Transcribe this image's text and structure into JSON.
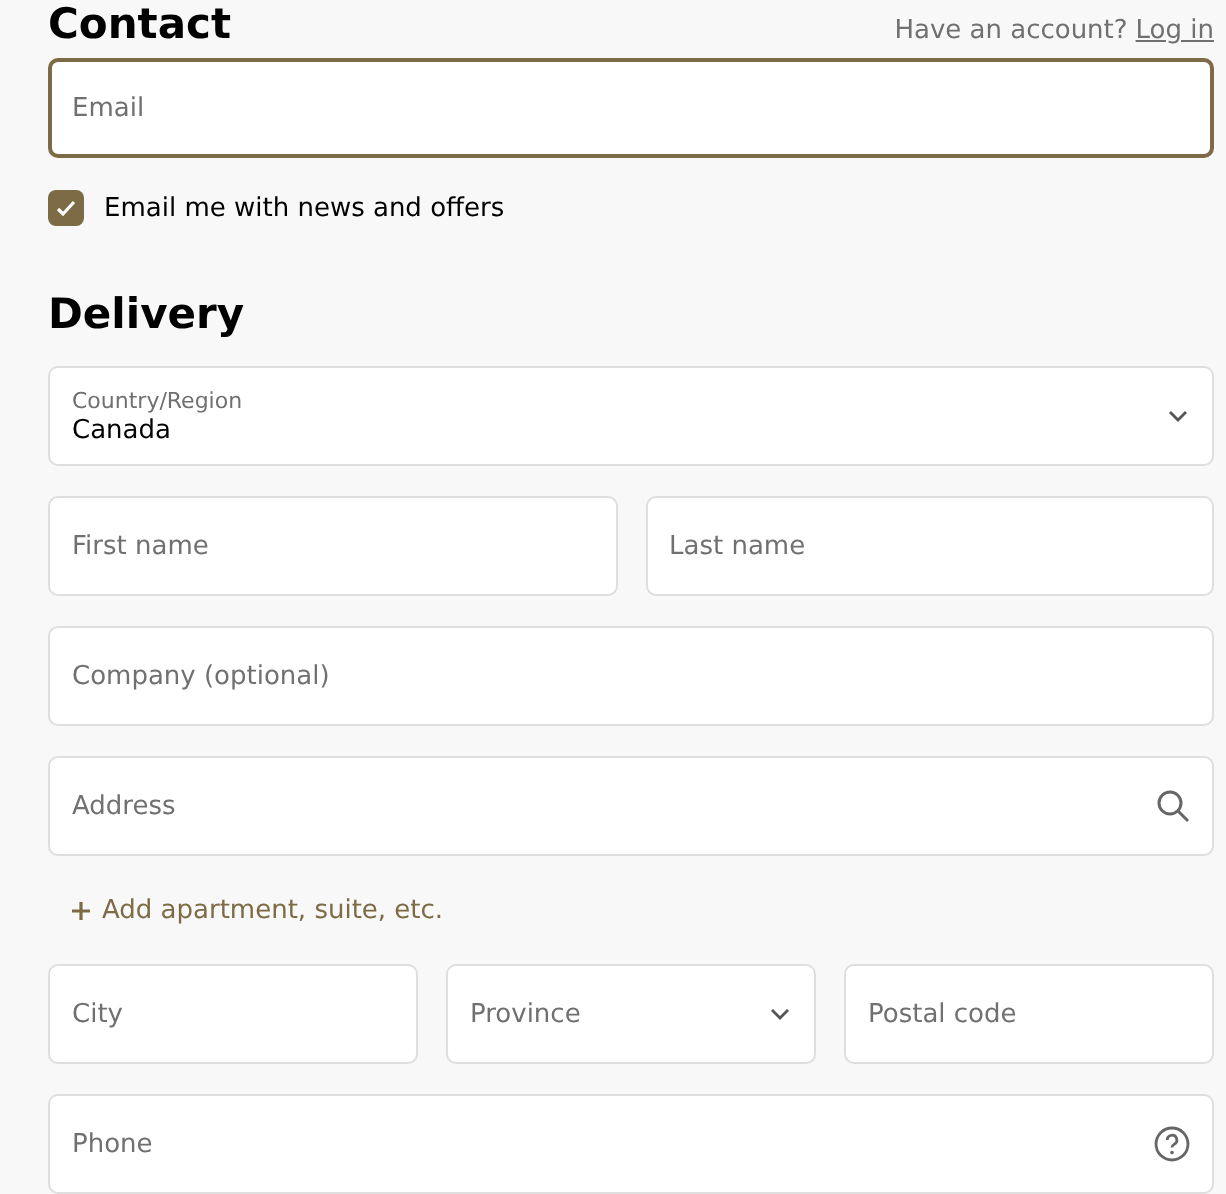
{
  "contact": {
    "heading": "Contact",
    "account_prompt": "Have an account?",
    "login_link": "Log in",
    "email": {
      "placeholder": "Email",
      "focused": true
    },
    "newsletter": {
      "label": "Email me with news and offers",
      "checked": true
    }
  },
  "delivery": {
    "heading": "Delivery",
    "rows": [
      [
        {
          "kind": "labeled-select",
          "label": "Country/Region",
          "value": "Canada"
        }
      ],
      [
        {
          "kind": "text",
          "placeholder": "First name"
        },
        {
          "kind": "text",
          "placeholder": "Last name"
        }
      ],
      [
        {
          "kind": "text",
          "placeholder": "Company (optional)"
        }
      ],
      [
        {
          "kind": "search",
          "placeholder": "Address"
        }
      ],
      [
        {
          "kind": "link",
          "label": "Add apartment, suite, etc."
        }
      ],
      [
        {
          "kind": "text",
          "placeholder": "City"
        },
        {
          "kind": "select",
          "placeholder": "Province"
        },
        {
          "kind": "text",
          "placeholder": "Postal code"
        }
      ],
      [
        {
          "kind": "help",
          "placeholder": "Phone"
        }
      ]
    ]
  }
}
